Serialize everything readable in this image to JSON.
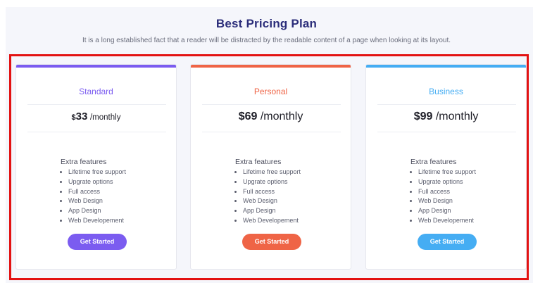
{
  "header": {
    "title": "Best Pricing Plan",
    "subtitle": "It is a long established fact that a reader will be distracted by the readable content of a page when looking at its layout."
  },
  "colors": {
    "standard": "#7b5cf0",
    "personal": "#ef6446",
    "business": "#45adf3",
    "title": "#2b2d7a",
    "highlight_border": "#e31212"
  },
  "plans": [
    {
      "name": "Standard",
      "currency": "$",
      "amount": "33",
      "period": "/monthly",
      "features_title": "Extra features",
      "features": [
        "Lifetime free support",
        "Upgrate options",
        "Full access",
        "Web Design",
        "App Design",
        "Web Developement"
      ],
      "cta": "Get Started"
    },
    {
      "name": "Personal",
      "currency": "$",
      "amount": "69",
      "period": "/monthly",
      "features_title": "Extra features",
      "features": [
        "Lifetime free support",
        "Upgrate options",
        "Full access",
        "Web Design",
        "App Design",
        "Web Developement"
      ],
      "cta": "Get Started"
    },
    {
      "name": "Business",
      "currency": "$",
      "amount": "99",
      "period": "/monthly",
      "features_title": "Extra features",
      "features": [
        "Lifetime free support",
        "Upgrate options",
        "Full access",
        "Web Design",
        "App Design",
        "Web Developement"
      ],
      "cta": "Get Started"
    }
  ]
}
